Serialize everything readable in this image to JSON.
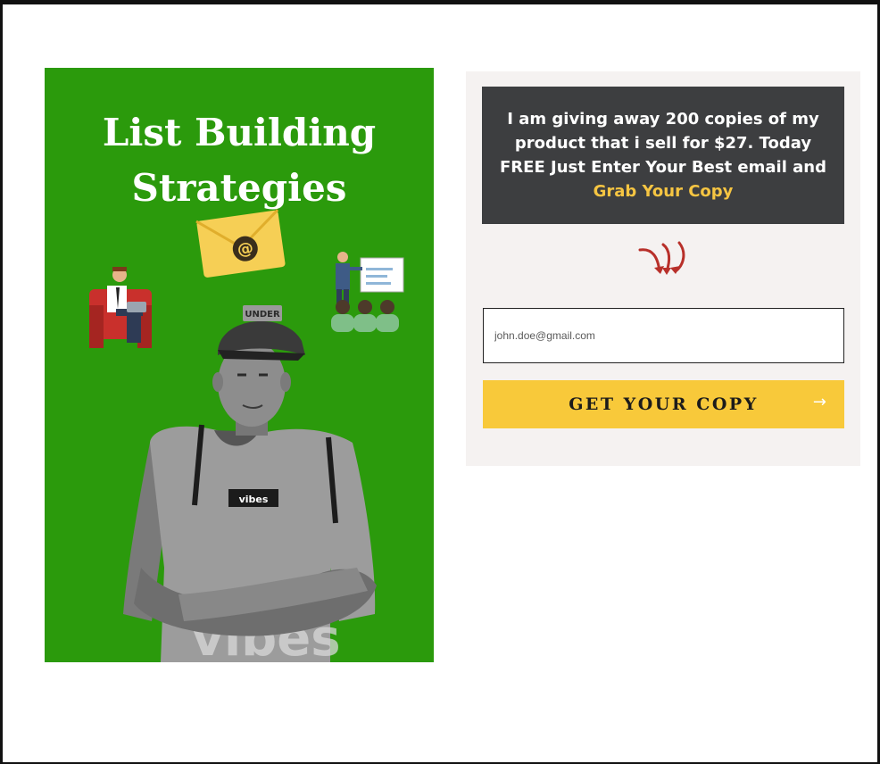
{
  "cover": {
    "title_line1": "List Building",
    "title_line2": "Strategies",
    "envelope_symbol": "@",
    "cap_text": "UNDER",
    "shirt_badge": "vibes",
    "shirt_print": "vibes",
    "background_color": "#2b9a0c"
  },
  "offer": {
    "line1": "I am giving away 200 copies of my",
    "line2": "product that i sell for $27.  Today",
    "line3": "FREE Just Enter Your Best email and",
    "highlight": "Grab Your Copy",
    "highlight_color": "#f6c542"
  },
  "arrows_icon": "curved-down-arrows-icon",
  "form": {
    "email_placeholder": "john.doe@gmail.com",
    "email_value": "",
    "button_label": "GET YOUR COPY",
    "button_arrow": "→",
    "button_color": "#f8c93a"
  }
}
